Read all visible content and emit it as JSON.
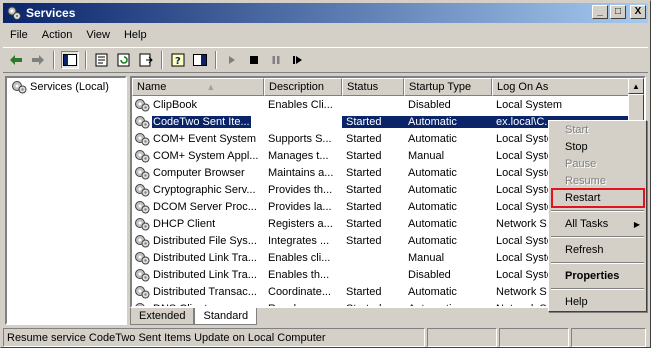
{
  "window": {
    "title": "Services"
  },
  "title_buttons": {
    "minimize": "_",
    "maximize": "□",
    "close": "X"
  },
  "menu": [
    {
      "label": "File",
      "key": "F"
    },
    {
      "label": "Action",
      "key": "A"
    },
    {
      "label": "View",
      "key": "V"
    },
    {
      "label": "Help",
      "key": "H"
    }
  ],
  "toolbar_icons": [
    "back-arrow-icon",
    "forward-arrow-icon",
    "show-hide-tree-icon",
    "properties-icon",
    "refresh-icon",
    "export-list-icon",
    "help-icon",
    "show-hide-pane-icon",
    "start-service-icon",
    "stop-service-icon",
    "pause-service-icon",
    "restart-service-icon"
  ],
  "tree": {
    "root_label": "Services (Local)"
  },
  "columns": [
    "Name",
    "Description",
    "Status",
    "Startup Type",
    "Log On As"
  ],
  "rows": [
    {
      "name": "ClipBook",
      "description": "Enables Cli...",
      "status": "",
      "startup": "Disabled",
      "logon": "Local System"
    },
    {
      "name": "CodeTwo Sent Ite...",
      "description": "",
      "status": "Started",
      "startup": "Automatic",
      "logon": "ex.local\\C...",
      "selected": true
    },
    {
      "name": "COM+ Event System",
      "description": "Supports S...",
      "status": "Started",
      "startup": "Automatic",
      "logon": "Local Syste"
    },
    {
      "name": "COM+ System Appl...",
      "description": "Manages t...",
      "status": "Started",
      "startup": "Manual",
      "logon": "Local Syste"
    },
    {
      "name": "Computer Browser",
      "description": "Maintains a...",
      "status": "Started",
      "startup": "Automatic",
      "logon": "Local Syste"
    },
    {
      "name": "Cryptographic Serv...",
      "description": "Provides th...",
      "status": "Started",
      "startup": "Automatic",
      "logon": "Local Syste"
    },
    {
      "name": "DCOM Server Proc...",
      "description": "Provides la...",
      "status": "Started",
      "startup": "Automatic",
      "logon": "Local Syste"
    },
    {
      "name": "DHCP Client",
      "description": "Registers a...",
      "status": "Started",
      "startup": "Automatic",
      "logon": "Network S"
    },
    {
      "name": "Distributed File Sys...",
      "description": "Integrates ...",
      "status": "Started",
      "startup": "Automatic",
      "logon": "Local Syste"
    },
    {
      "name": "Distributed Link Tra...",
      "description": "Enables cli...",
      "status": "",
      "startup": "Manual",
      "logon": "Local Syste"
    },
    {
      "name": "Distributed Link Tra...",
      "description": "Enables th...",
      "status": "",
      "startup": "Disabled",
      "logon": "Local Syste"
    },
    {
      "name": "Distributed Transac...",
      "description": "Coordinate...",
      "status": "Started",
      "startup": "Automatic",
      "logon": "Network S"
    },
    {
      "name": "DNS Client",
      "description": "Resolves a...",
      "status": "Started",
      "startup": "Automatic",
      "logon": "Network S"
    }
  ],
  "tabs": [
    "Extended",
    "Standard"
  ],
  "active_tab": "Standard",
  "status_text": "Resume service CodeTwo Sent Items Update on Local Computer",
  "context_menu": {
    "start": "Start",
    "stop": "Stop",
    "pause": "Pause",
    "resume": "Resume",
    "restart": "Restart",
    "all_tasks": "All Tasks",
    "refresh": "Refresh",
    "properties": "Properties",
    "help": "Help"
  },
  "colors": {
    "title_start": "#0a246a",
    "title_end": "#a6caf0",
    "selection": "#0a246a",
    "highlight_box": "#e0141e"
  }
}
